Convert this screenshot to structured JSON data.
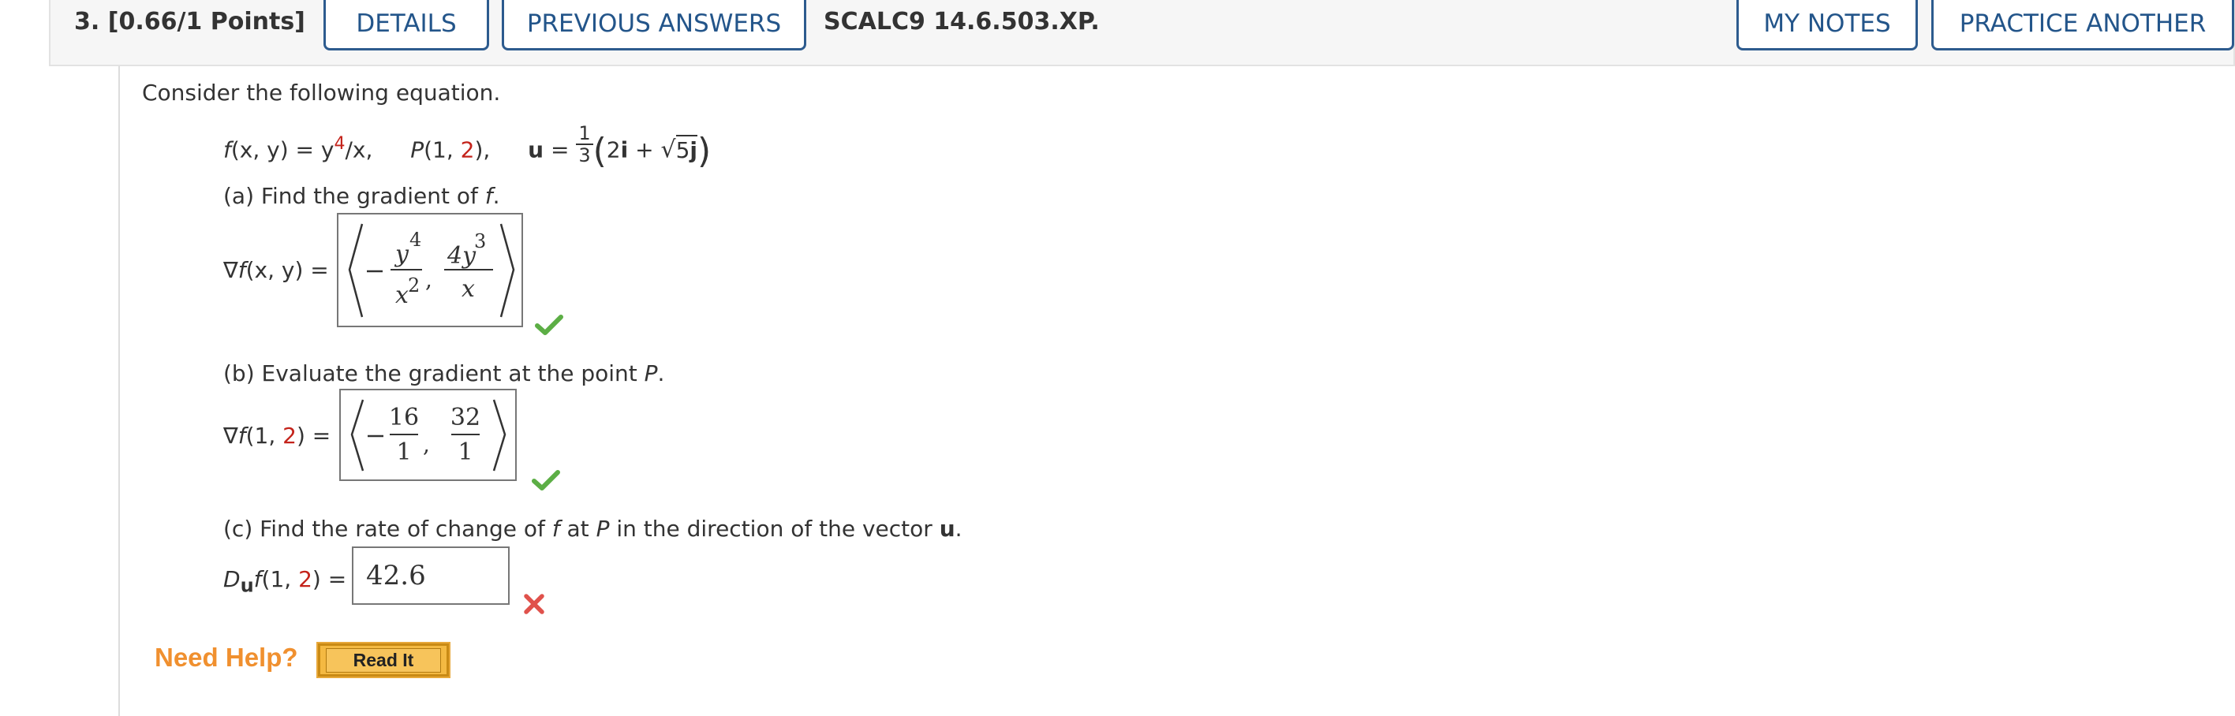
{
  "header": {
    "question_number": "3.",
    "points": "[0.66/1 Points]",
    "details_label": "DETAILS",
    "previous_answers_label": "PREVIOUS ANSWERS",
    "problem_code": "SCALC9 14.6.503.XP.",
    "my_notes_label": "MY NOTES",
    "practice_another_label": "PRACTICE ANOTHER"
  },
  "problem": {
    "intro": "Consider the following equation.",
    "func_name": "f",
    "vars": "(x, y) = y",
    "exp_4": "4",
    "slash_x": "/x,",
    "point_name": "P",
    "point_x": "(1, ",
    "point_y": "2",
    "point_close": "),",
    "u_label": "u",
    "eq": " = ",
    "u_frac_num": "1",
    "u_frac_den": "3",
    "u_vec_a": "2",
    "i_label": "i",
    "plus": " + ",
    "sqrt_val": "5",
    "j_label": "j"
  },
  "part_a": {
    "prompt_pre": "(a) Find the gradient of ",
    "prompt_f": "f",
    "prompt_post": ".",
    "label_nabla": "∇",
    "label_f": "f",
    "label_args": "(x, y) =",
    "minus": "−",
    "num1": "y",
    "num1_exp": "4",
    "den1": "x",
    "den1_exp": "2",
    "num2": "4y",
    "num2_exp": "3",
    "den2": "x",
    "status": "correct"
  },
  "part_b": {
    "prompt_pre": "(b) Evaluate the gradient at the point ",
    "prompt_p": "P",
    "prompt_post": ".",
    "label_nabla": "∇",
    "label_f": "f",
    "label_open": "(1, ",
    "label_y": "2",
    "label_close": ") =",
    "minus": "−",
    "num1": "16",
    "den1": "1",
    "num2": "32",
    "den2": "1",
    "status": "correct"
  },
  "part_c": {
    "prompt_pre": "(c) Find the rate of change of ",
    "prompt_f": "f",
    "prompt_mid": " at ",
    "prompt_p": "P",
    "prompt_mid2": " in the direction of the vector ",
    "prompt_u": "u",
    "prompt_post": ".",
    "label_D": "D",
    "label_u": "u",
    "label_f": "f",
    "label_open": "(1, ",
    "label_y": "2",
    "label_close": ") =",
    "answer_value": "42.6",
    "status": "incorrect"
  },
  "help": {
    "need_help_label": "Need Help?",
    "read_it_label": "Read It"
  },
  "colors": {
    "button_border": "#2d5b8e",
    "button_text": "#23558a",
    "red_value": "#c4231b",
    "check_green": "#5cae45",
    "x_red": "#e0524c",
    "help_orange": "#f0902f"
  }
}
